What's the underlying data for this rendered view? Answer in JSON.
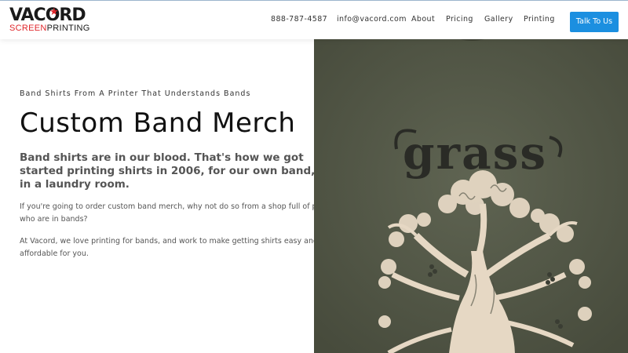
{
  "brand": {
    "logo_top": "VACORD",
    "logo_bottom_red": "SCREEN",
    "logo_bottom_dark": "PRINTING",
    "accent": "#e0262b"
  },
  "nav": {
    "phone": "888-787-4587",
    "email": "info@vacord.com",
    "items": [
      "About",
      "Pricing",
      "Gallery",
      "Printing"
    ],
    "cta": "Talk To Us",
    "cta_color": "#1b8fe0"
  },
  "hero": {
    "eyebrow": "Band Shirts From A Printer That Understands Bands",
    "title": "Custom Band Merch",
    "lead_lines": [
      "Band shirts are in our blood. That's how we got",
      "started printing shirts in 2006, for our own band,",
      "in a laundry room."
    ],
    "paragraphs": [
      [
        "If you're going to order custom band merch, why not do so from a shop full of people",
        "who are in bands?"
      ],
      [
        "At Vacord, we love printing for bands, and work to make getting shirts easy and",
        "affordable for you."
      ]
    ],
    "image_shirt_text": "grass",
    "image_shirt_color": "#555a49"
  }
}
